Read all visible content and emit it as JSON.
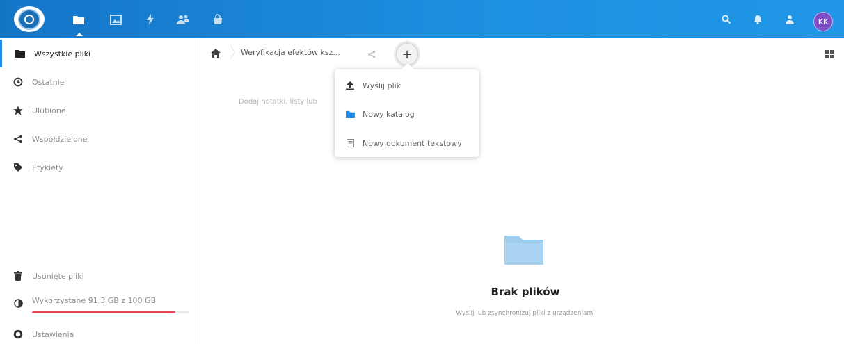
{
  "header": {
    "apps": [
      {
        "name": "files",
        "icon": "folder-icon"
      },
      {
        "name": "photos",
        "icon": "image-icon"
      },
      {
        "name": "activity",
        "icon": "lightning-icon"
      },
      {
        "name": "contacts",
        "icon": "contacts-icon"
      },
      {
        "name": "store",
        "icon": "shopping-bag-icon"
      }
    ],
    "right_icons": [
      "search-icon",
      "notifications-icon",
      "contacts-menu-icon"
    ],
    "avatar_initials": "KK",
    "accent_color": "#1e88e5",
    "avatar_color": "#7e4fc6"
  },
  "sidebar": {
    "items": [
      {
        "label": "Wszystkie pliki",
        "icon": "folder-icon",
        "active": true
      },
      {
        "label": "Ostatnie",
        "icon": "clock-icon"
      },
      {
        "label": "Ulubione",
        "icon": "star-icon"
      },
      {
        "label": "Współdzielone",
        "icon": "share-icon"
      },
      {
        "label": "Etykiety",
        "icon": "tag-icon"
      }
    ],
    "bottom": {
      "trash_label": "Usunięte pliki",
      "quota_label": "Wykorzystane 91,3 GB z 100 GB",
      "quota_fraction": 0.913,
      "quota_color": "#e9495f",
      "settings_label": "Ustawienia"
    }
  },
  "breadcrumb": {
    "home_icon": "home-icon",
    "current": "Weryfikacja efektów ksz..."
  },
  "new_menu": {
    "button_label": "+",
    "items": [
      {
        "label": "Wyślij plik",
        "icon": "upload-icon"
      },
      {
        "label": "Nowy katalog",
        "icon": "folder-icon"
      },
      {
        "label": "Nowy dokument tekstowy",
        "icon": "text-document-icon"
      }
    ]
  },
  "hint_text": "Dodaj notatki, listy lub",
  "empty": {
    "title": "Brak plików",
    "subtitle": "Wyślij lub zsynchronizuj pliki z urządzeniami"
  }
}
